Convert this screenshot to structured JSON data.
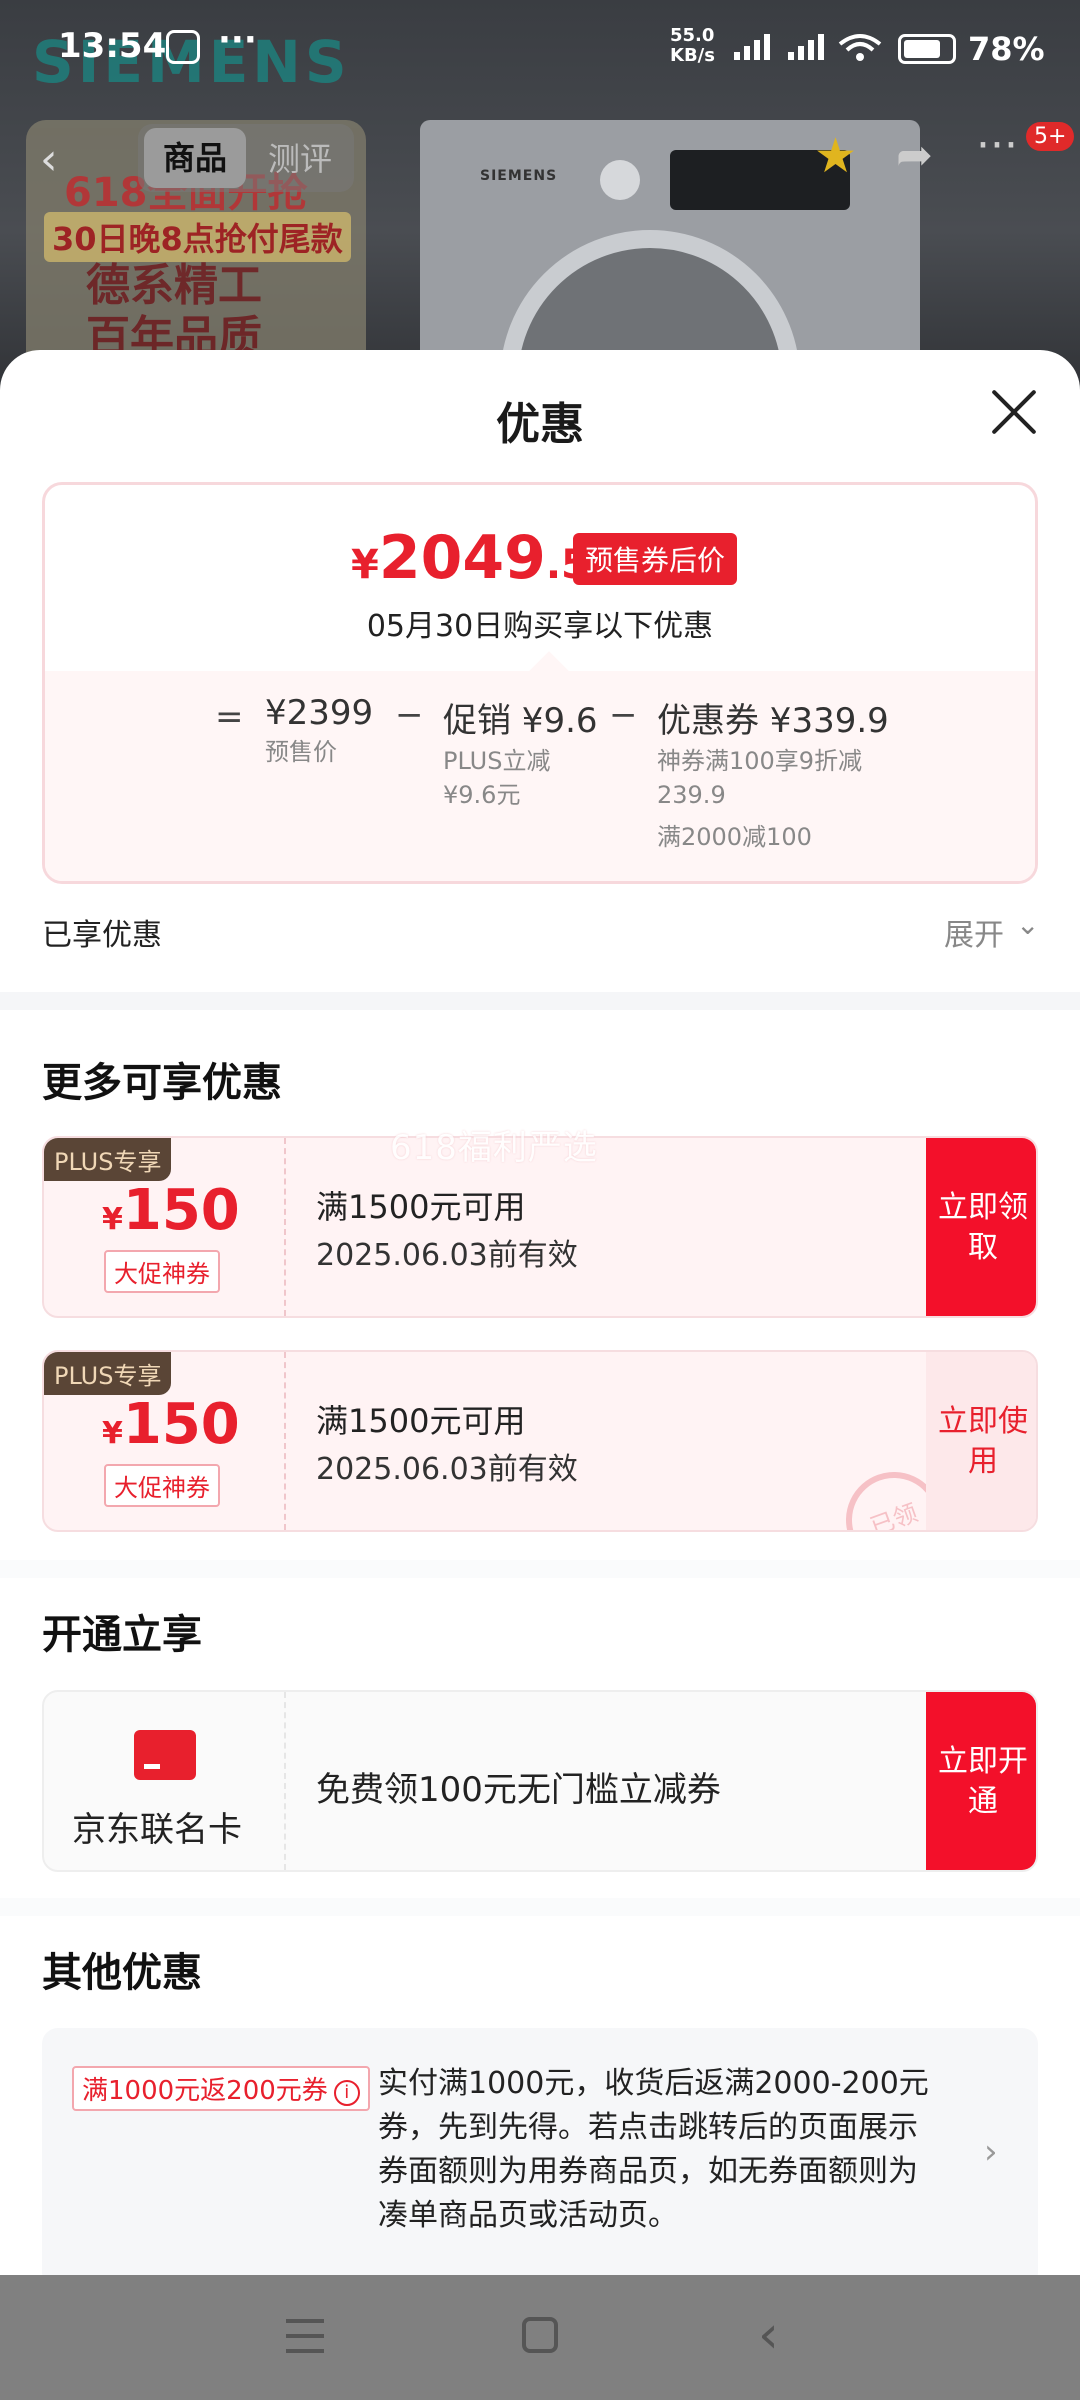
{
  "status_bar": {
    "time": "13:54",
    "more": "···",
    "net_speed": "55.0",
    "net_unit": "KB/s",
    "battery": "78%"
  },
  "backdrop": {
    "brand": "SIEMENS",
    "poster_line1": "618全面开抢",
    "poster_line2": "30日晚8点抢付尾款",
    "poster_line3a": "德系精工",
    "poster_line3b": "百年品质",
    "washer_logo": "SIEMENS"
  },
  "nav": {
    "back": "‹",
    "tab_product": "商品",
    "tab_review": "测评",
    "badge": "5+"
  },
  "sheet": {
    "title": "优惠"
  },
  "price_card": {
    "currency": "¥",
    "price_int": "2049",
    "price_dec": ".5",
    "tag": "预售券后价",
    "subtitle": "05月30日购买享以下优惠",
    "eq": "=",
    "base_value": "¥2399",
    "base_desc": "预售价",
    "minus": "−",
    "promo_value": "促销 ¥9.6",
    "promo_desc1": "PLUS立减",
    "promo_desc2": "¥9.6元",
    "coupon_value": "优惠券 ¥339.9",
    "coupon_desc1": "神券满100享9折减",
    "coupon_desc2": "239.9",
    "coupon_desc3": "满2000减100"
  },
  "enjoyed": {
    "label": "已享优惠",
    "expand": "展开",
    "chevron": "⌄"
  },
  "more_offers": {
    "title": "更多可享优惠",
    "watermark": "618福利严选",
    "coupons": [
      {
        "plus": "PLUS专享",
        "currency": "¥",
        "amount": "150",
        "tag": "大促神券",
        "condition": "满1500元可用",
        "expiry": "2025.06.03前有效",
        "action": "立即领取"
      },
      {
        "plus": "PLUS专享",
        "currency": "¥",
        "amount": "150",
        "tag": "大促神券",
        "condition": "满1500元可用",
        "expiry": "2025.06.03前有效",
        "action": "立即使用",
        "stamp": "已领"
      }
    ]
  },
  "open_offer": {
    "title": "开通立享",
    "card_name": "京东联名卡",
    "description": "免费领100元无门槛立减券",
    "action": "立即开通"
  },
  "other_offers": {
    "title": "其他优惠",
    "tag": "满1000元返200元券",
    "info_icon": "i",
    "description": "实付满1000元，收货后返满2000-200元券，先到先得。若点击跳转后的页面展示券面额则为用券商品页，如无券面额则为凑单商品页或活动页。",
    "chevron": "›"
  },
  "icons": {
    "accent": "#e8202d"
  }
}
